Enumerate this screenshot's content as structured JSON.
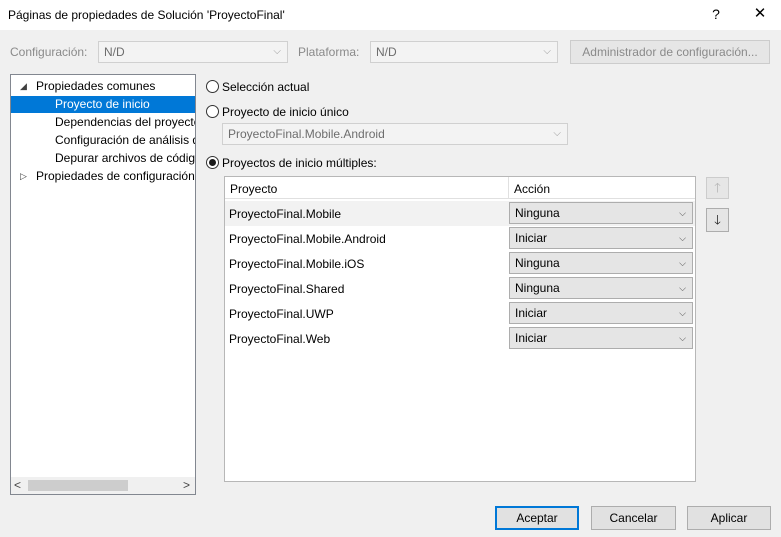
{
  "window": {
    "title": "Páginas de propiedades de Solución 'ProyectoFinal'",
    "help_label": "?",
    "close_label": "✕"
  },
  "config_bar": {
    "configuration_label": "Configuración:",
    "configuration_value": "N/D",
    "platform_label": "Plataforma:",
    "platform_value": "N/D",
    "manager_button": "Administrador de configuración..."
  },
  "tree": {
    "items": [
      {
        "label": "Propiedades comunes",
        "expanded": true,
        "twisty": "◢"
      },
      {
        "label": "Proyecto de inicio",
        "selected": true
      },
      {
        "label": "Dependencias del proyecto"
      },
      {
        "label": "Configuración de análisis de código"
      },
      {
        "label": "Depurar archivos de código fuente"
      },
      {
        "label": "Propiedades de configuración",
        "expanded": false,
        "twisty": "▷"
      }
    ],
    "scroll_left": "<",
    "scroll_right": ">"
  },
  "options": {
    "current_selection": "Selección actual",
    "single_startup": "Proyecto de inicio único",
    "single_startup_value": "ProyectoFinal.Mobile.Android",
    "multiple_startup": "Proyectos de inicio múltiples:",
    "selected": "multiple"
  },
  "grid": {
    "headers": [
      "Proyecto",
      "Acción"
    ],
    "rows": [
      {
        "project": "ProyectoFinal.Mobile",
        "action": "Ninguna"
      },
      {
        "project": "ProyectoFinal.Mobile.Android",
        "action": "Iniciar"
      },
      {
        "project": "ProyectoFinal.Mobile.iOS",
        "action": "Ninguna"
      },
      {
        "project": "ProyectoFinal.Shared",
        "action": "Ninguna"
      },
      {
        "project": "ProyectoFinal.UWP",
        "action": "Iniciar"
      },
      {
        "project": "ProyectoFinal.Web",
        "action": "Iniciar"
      }
    ]
  },
  "move": {
    "up": "🡑",
    "down": "🡓"
  },
  "footer": {
    "accept": "Aceptar",
    "cancel": "Cancelar",
    "apply": "Aplicar"
  },
  "colors": {
    "accent": "#0078d7",
    "selection_bg": "#0078d7"
  }
}
